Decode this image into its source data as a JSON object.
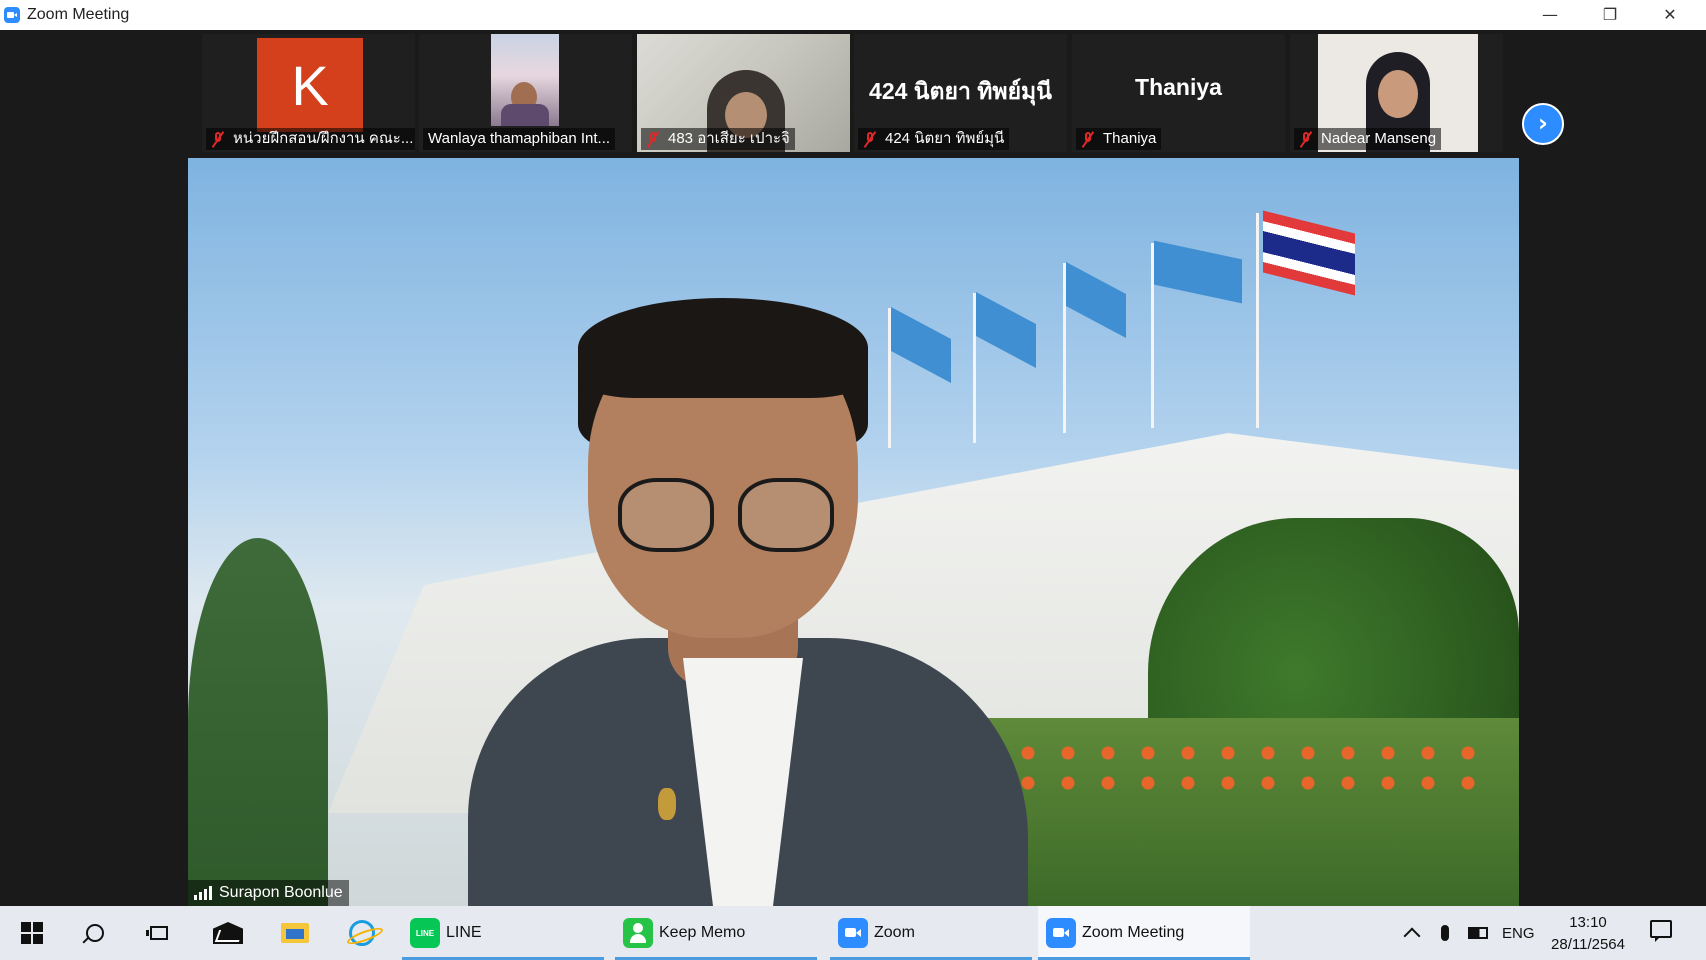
{
  "window": {
    "title": "Zoom Meeting",
    "minimize": "—",
    "restore": "❐",
    "close": "✕"
  },
  "gallery": {
    "participants": [
      {
        "name": "หน่วยฝึกสอน/ฝึกงาน คณะ...",
        "avatar_letter": "K",
        "muted": true,
        "video": false,
        "avatar_color": "#d4401b"
      },
      {
        "name": "Wanlaya thamaphiban Int...",
        "muted": false,
        "video": true
      },
      {
        "name": "483 อาเสียะ เปาะจิ",
        "muted": true,
        "video": true
      },
      {
        "name": "424 นิตยา ทิพย์มุนี",
        "display_name": "424 นิตยา ทิพย์มุนี",
        "muted": true,
        "video": false
      },
      {
        "name": "Thaniya",
        "display_name": "Thaniya",
        "muted": true,
        "video": false
      },
      {
        "name": "Nadear Manseng",
        "muted": true,
        "video": true
      }
    ],
    "next_page_icon": "›"
  },
  "main": {
    "speaker_name": "Surapon Boonlue",
    "signal_icon": "signal-bars-icon"
  },
  "taskbar": {
    "apps": [
      {
        "label": "LINE",
        "icon_text": "LINE"
      },
      {
        "label": "Keep Memo"
      },
      {
        "label": "Zoom"
      },
      {
        "label": "Zoom Meeting"
      }
    ],
    "language": "ENG",
    "time": "13:10",
    "date": "28/11/2564"
  },
  "colors": {
    "accent": "#2d8cff",
    "mute_red": "#e02828",
    "taskbar_bg": "#e6eaf0",
    "active_underline": "#4a9be0"
  }
}
